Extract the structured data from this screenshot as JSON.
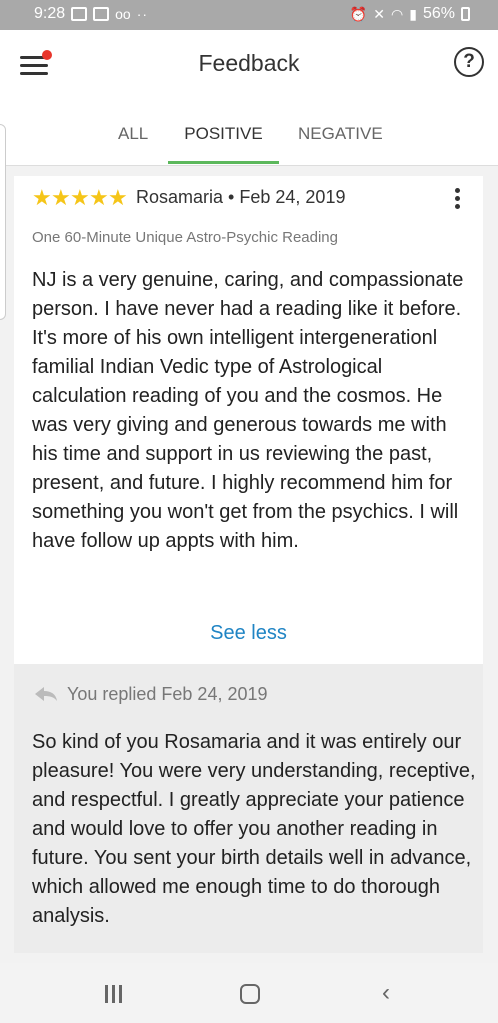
{
  "status_bar": {
    "time": "9:28",
    "battery": "56%"
  },
  "app_bar": {
    "title": "Feedback",
    "help_glyph": "?"
  },
  "tabs": [
    {
      "label": "ALL",
      "active": false
    },
    {
      "label": "POSITIVE",
      "active": true
    },
    {
      "label": "NEGATIVE",
      "active": false
    }
  ],
  "review": {
    "rating": 5,
    "reviewer": "Rosamaria",
    "separator": "•",
    "date": "Feb 24, 2019",
    "product": "One 60-Minute Unique Astro-Psychic Reading",
    "text": "NJ is a very genuine, caring, and compassionate person. I have never had a reading like it before. It's more of his own intelligent intergenerationl familial Indian Vedic type of Astrological calculation reading of you and the cosmos. He was very giving and generous towards me with his time and support in us reviewing the past, present, and future. I highly recommend him for something you won't get from the psychics. I will have follow up appts with him.",
    "see_less": "See less"
  },
  "reply": {
    "label": "You replied Feb 24, 2019",
    "text": "So kind of you Rosamaria and it was entirely our pleasure! You were very understanding, receptive, and respectful. I greatly appreciate your patience and would love to offer you another reading in future. You sent your birth details well in advance, which allowed me enough time to do thorough analysis."
  },
  "colors": {
    "accent_green": "#5cb85c",
    "link_blue": "#1f84c4",
    "star_gold": "#f5c518",
    "notification_red": "#e8352b"
  },
  "icons": {
    "menu": "hamburger-menu-icon",
    "help": "help-circle-icon",
    "more": "more-vertical-icon",
    "reply": "reply-arrow-icon",
    "nav_recents": "recents-icon",
    "nav_home": "home-icon",
    "nav_back": "back-icon"
  }
}
